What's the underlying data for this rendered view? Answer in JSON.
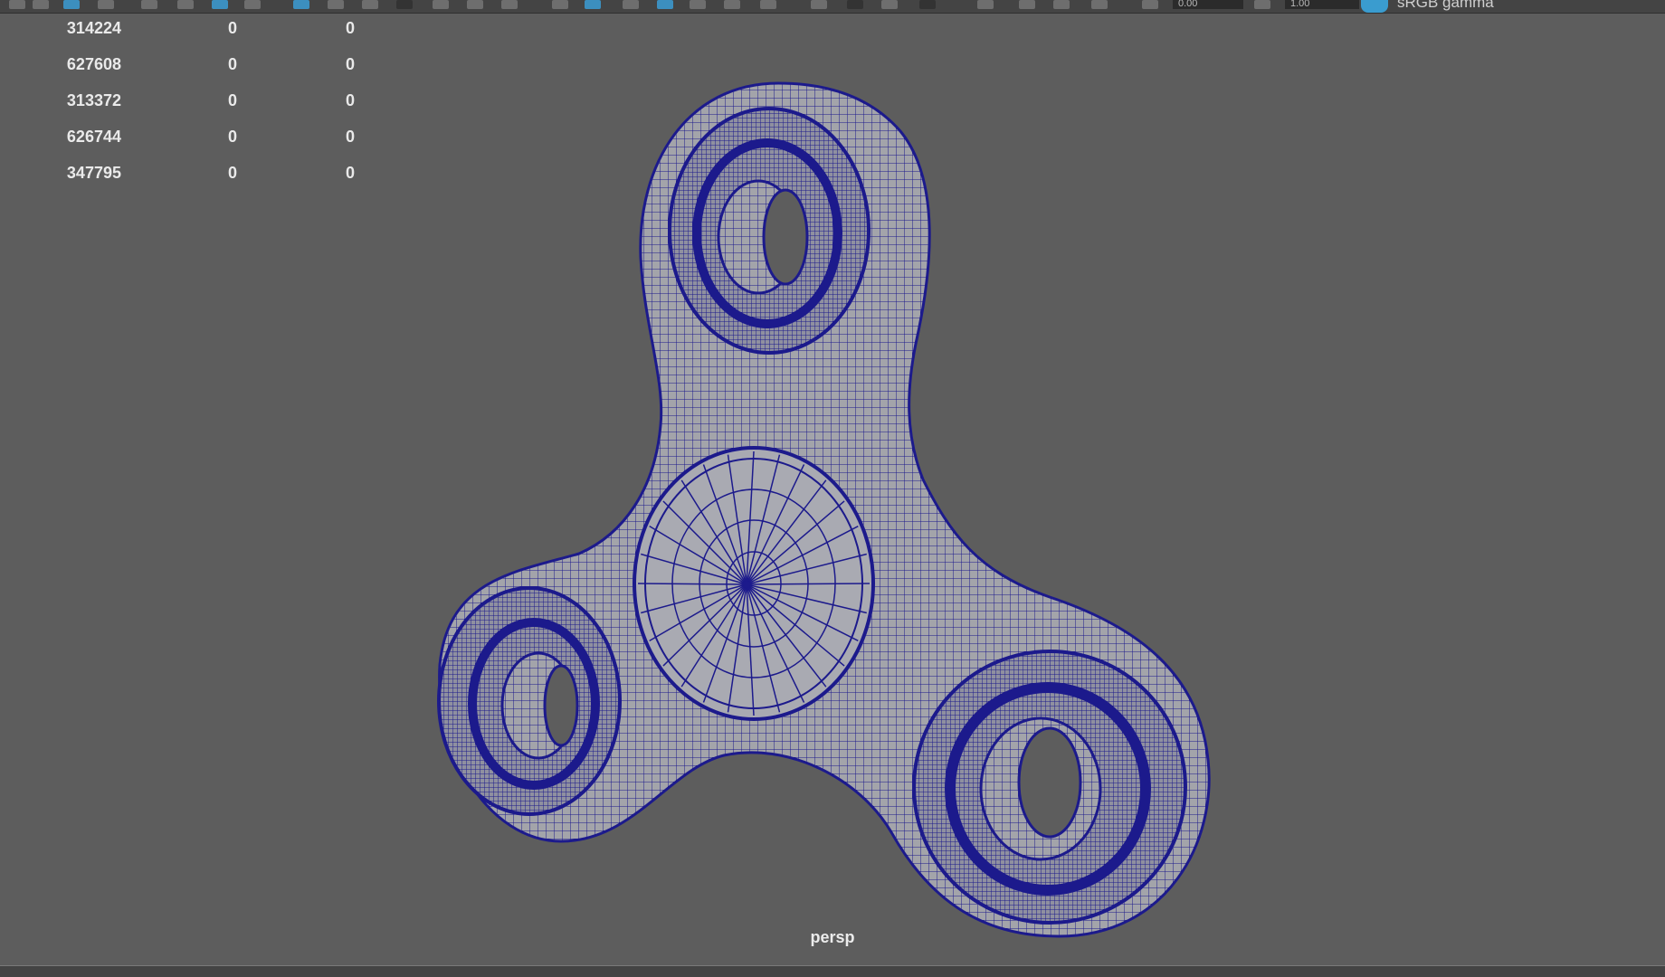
{
  "toolbar": {
    "exposure_value": "0.00",
    "gamma_value": "1.00",
    "color_space": "sRGB gamma"
  },
  "hud": {
    "rows": [
      [
        "314224",
        "0",
        "0"
      ],
      [
        "627608",
        "0",
        "0"
      ],
      [
        "313372",
        "0",
        "0"
      ],
      [
        "626744",
        "0",
        "0"
      ],
      [
        "347795",
        "0",
        "0"
      ]
    ]
  },
  "viewport": {
    "camera": "persp",
    "model": "fidget-spinner",
    "wire_color": "#1c1a8c",
    "shade_color": "#9fa0a6",
    "background_color": "#5d5d5d"
  }
}
